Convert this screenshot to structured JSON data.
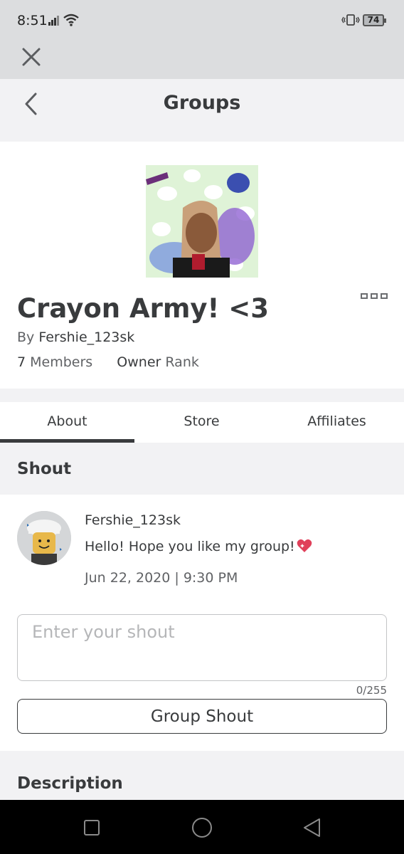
{
  "status_bar": {
    "time": "8:51",
    "battery": "74",
    "icons": [
      "signal-icon",
      "wifi-icon",
      "vibrate-icon",
      "battery-icon"
    ]
  },
  "header": {
    "title": "Groups",
    "icons": [
      "close-icon",
      "back-icon"
    ]
  },
  "group": {
    "name": "Crayon Army! <3",
    "by_label": "By",
    "owner": "Fershie_123sk",
    "member_count": "7",
    "members_label": "Members",
    "rank": "Owner",
    "rank_label": "Rank",
    "more_icon": "more-options-icon"
  },
  "tabs": [
    {
      "label": "About",
      "active": true
    },
    {
      "label": "Store",
      "active": false
    },
    {
      "label": "Affiliates",
      "active": false
    }
  ],
  "shout": {
    "title": "Shout",
    "poster": "Fershie_123sk",
    "message": "Hello! Hope you like my group!",
    "message_emoji": "sparkling-heart-icon",
    "date": "Jun 22, 2020 | 9:30 PM",
    "input_placeholder": "Enter your shout",
    "input_value": "",
    "char_count": "0/255",
    "button_label": "Group Shout"
  },
  "description": {
    "title": "Description"
  },
  "nav": {
    "icons": [
      "recents-icon",
      "home-icon",
      "back-nav-icon"
    ]
  },
  "colors": {
    "text": "#393b3d",
    "muted": "#606265",
    "background": "#f2f2f4",
    "card": "#ffffff",
    "statusbar": "#dcdddf",
    "heart": "#e0405a"
  }
}
